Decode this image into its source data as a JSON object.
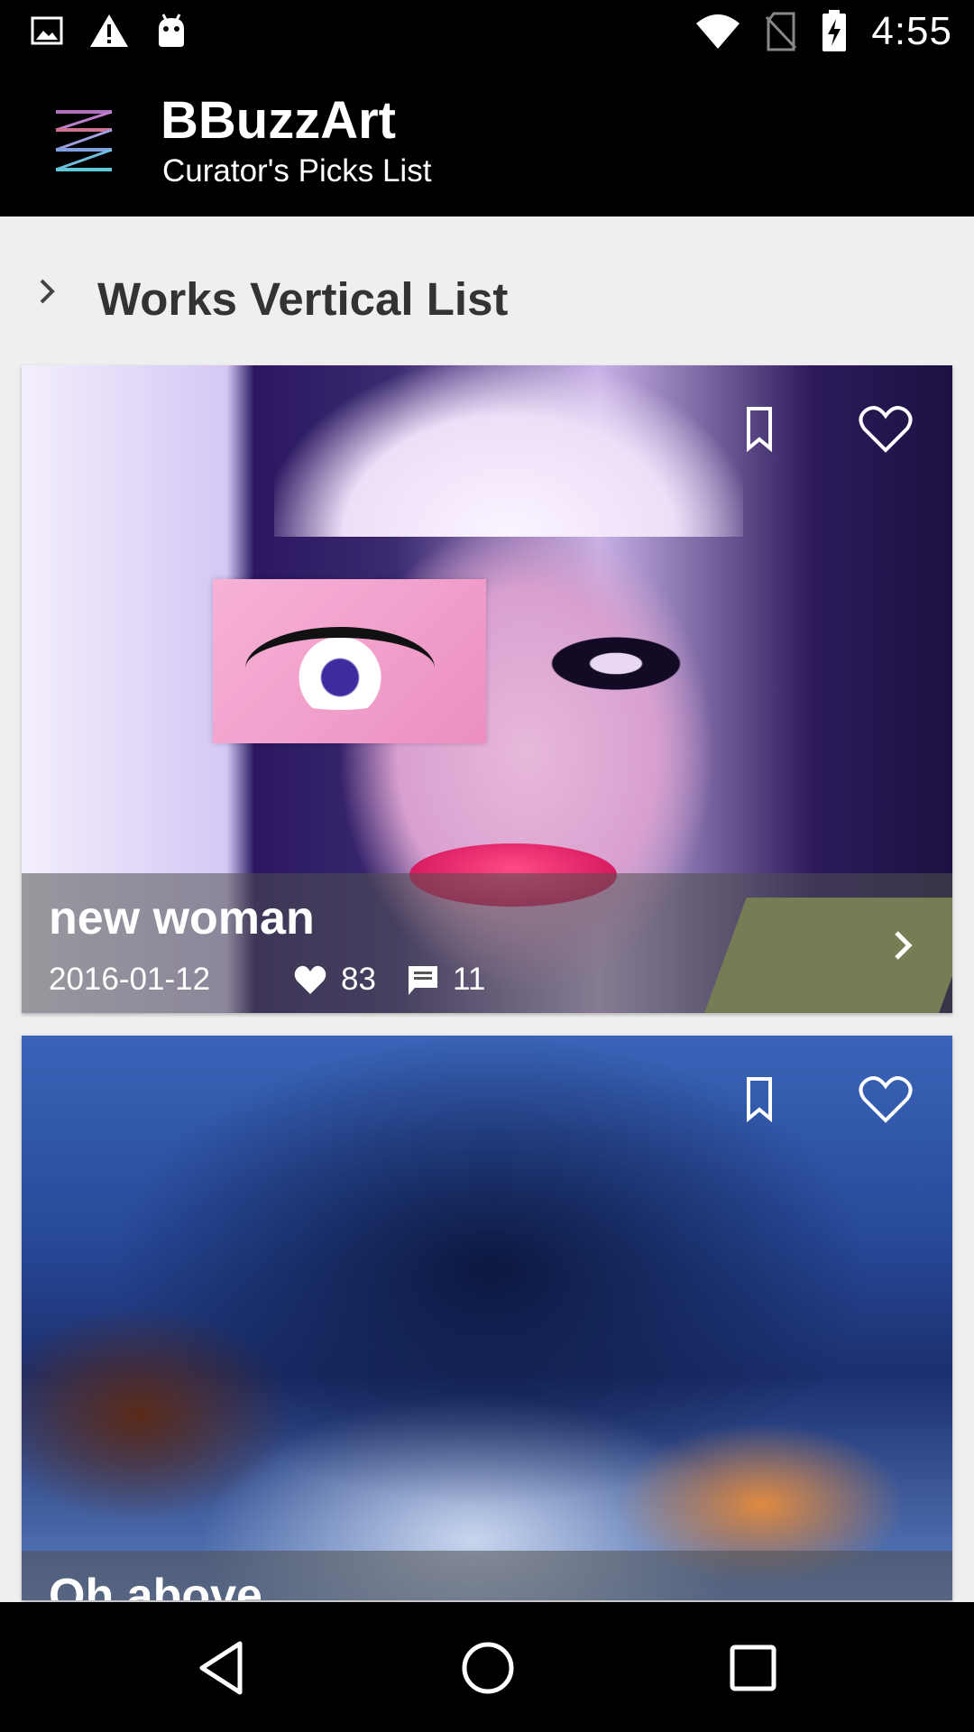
{
  "status_bar": {
    "time": "4:55",
    "left_icons": [
      "image-icon",
      "warning-icon",
      "android-icon"
    ],
    "right_icons": [
      "wifi-icon",
      "no-sim-icon",
      "battery-charging-icon"
    ]
  },
  "app_bar": {
    "title": "BBuzzArt",
    "subtitle": "Curator's Picks List"
  },
  "section": {
    "title": "Works Vertical List"
  },
  "works": [
    {
      "title": "new woman",
      "date": "2016-01-12",
      "likes": "83",
      "comments": "11"
    },
    {
      "title": "Oh above"
    }
  ],
  "colors": {
    "app_bar_bg": "#000000",
    "page_bg": "#efefef",
    "section_title": "#333333"
  }
}
